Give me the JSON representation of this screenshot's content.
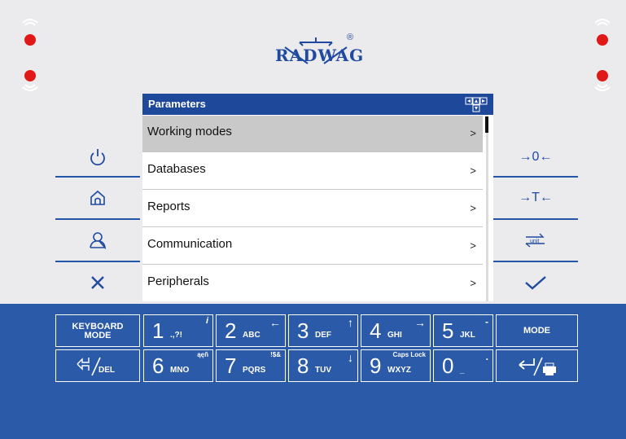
{
  "brand": {
    "logo_text": "RADWAG",
    "reg_mark": "®"
  },
  "panel": {
    "title": "Parameters",
    "items": [
      {
        "label": "Working modes",
        "arrow": ">"
      },
      {
        "label": "Databases",
        "arrow": ">"
      },
      {
        "label": "Reports",
        "arrow": ">"
      },
      {
        "label": "Communication",
        "arrow": ">"
      },
      {
        "label": "Peripherals",
        "arrow": ">"
      }
    ]
  },
  "side_right": {
    "zero": "→0←",
    "tare": "→T←"
  },
  "keypad": {
    "keyboard_mode": [
      "KEYBOARD",
      "MODE"
    ],
    "mode": "MODE",
    "del": "DEL",
    "k1": {
      "num": "1",
      "sub": ".,?!",
      "top": "i"
    },
    "k2": {
      "num": "2",
      "sub": "ABC",
      "top": "←"
    },
    "k3": {
      "num": "3",
      "sub": "DEF",
      "top": "↑"
    },
    "k4": {
      "num": "4",
      "sub": "GHI",
      "top": "→"
    },
    "k5": {
      "num": "5",
      "sub": "JKL",
      "top": "-"
    },
    "k6": {
      "num": "6",
      "sub": "MNO",
      "top": "ąęñ"
    },
    "k7": {
      "num": "7",
      "sub": "PQRS",
      "top": "!$&"
    },
    "k8": {
      "num": "8",
      "sub": "TUV",
      "top": "↓"
    },
    "k9": {
      "num": "9",
      "sub": "WXYZ",
      "top": "Caps Lock"
    },
    "k0": {
      "num": "0",
      "sub": "_",
      "top": "."
    }
  },
  "colors": {
    "accent": "#1e489a",
    "led": "#e01818",
    "keypad_bg": "#2b5aa8",
    "selected_row": "#c9c9c9"
  }
}
